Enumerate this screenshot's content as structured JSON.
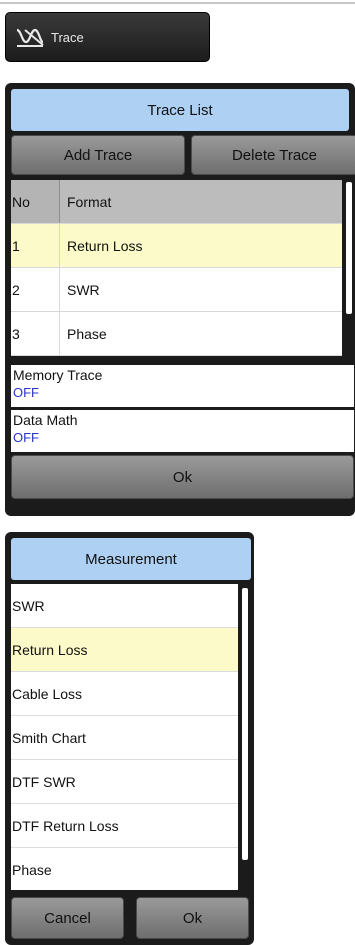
{
  "trace_button": {
    "label": "Trace",
    "icon": "trace-icon"
  },
  "trace_list": {
    "title": "Trace List",
    "add_label": "Add Trace",
    "delete_label": "Delete Trace",
    "columns": {
      "no": "No",
      "format": "Format"
    },
    "rows": [
      {
        "no": "1",
        "format": "Return Loss",
        "selected": true
      },
      {
        "no": "2",
        "format": "SWR"
      },
      {
        "no": "3",
        "format": "Phase"
      }
    ],
    "memory_trace": {
      "label": "Memory Trace",
      "value": "OFF"
    },
    "data_math": {
      "label": "Data Math",
      "value": "OFF"
    },
    "ok_label": "Ok"
  },
  "measurement": {
    "title": "Measurement",
    "items": [
      {
        "label": "SWR"
      },
      {
        "label": "Return Loss",
        "selected": true
      },
      {
        "label": "Cable Loss"
      },
      {
        "label": "Smith Chart"
      },
      {
        "label": "DTF SWR"
      },
      {
        "label": "DTF Return Loss"
      },
      {
        "label": "Phase"
      }
    ],
    "cancel_label": "Cancel",
    "ok_label": "Ok"
  },
  "colors": {
    "title_bar": "#aed0f3",
    "selected_row": "#fdfac9",
    "value_text": "#2a33c8",
    "panel_bg": "#1b1b1b"
  }
}
